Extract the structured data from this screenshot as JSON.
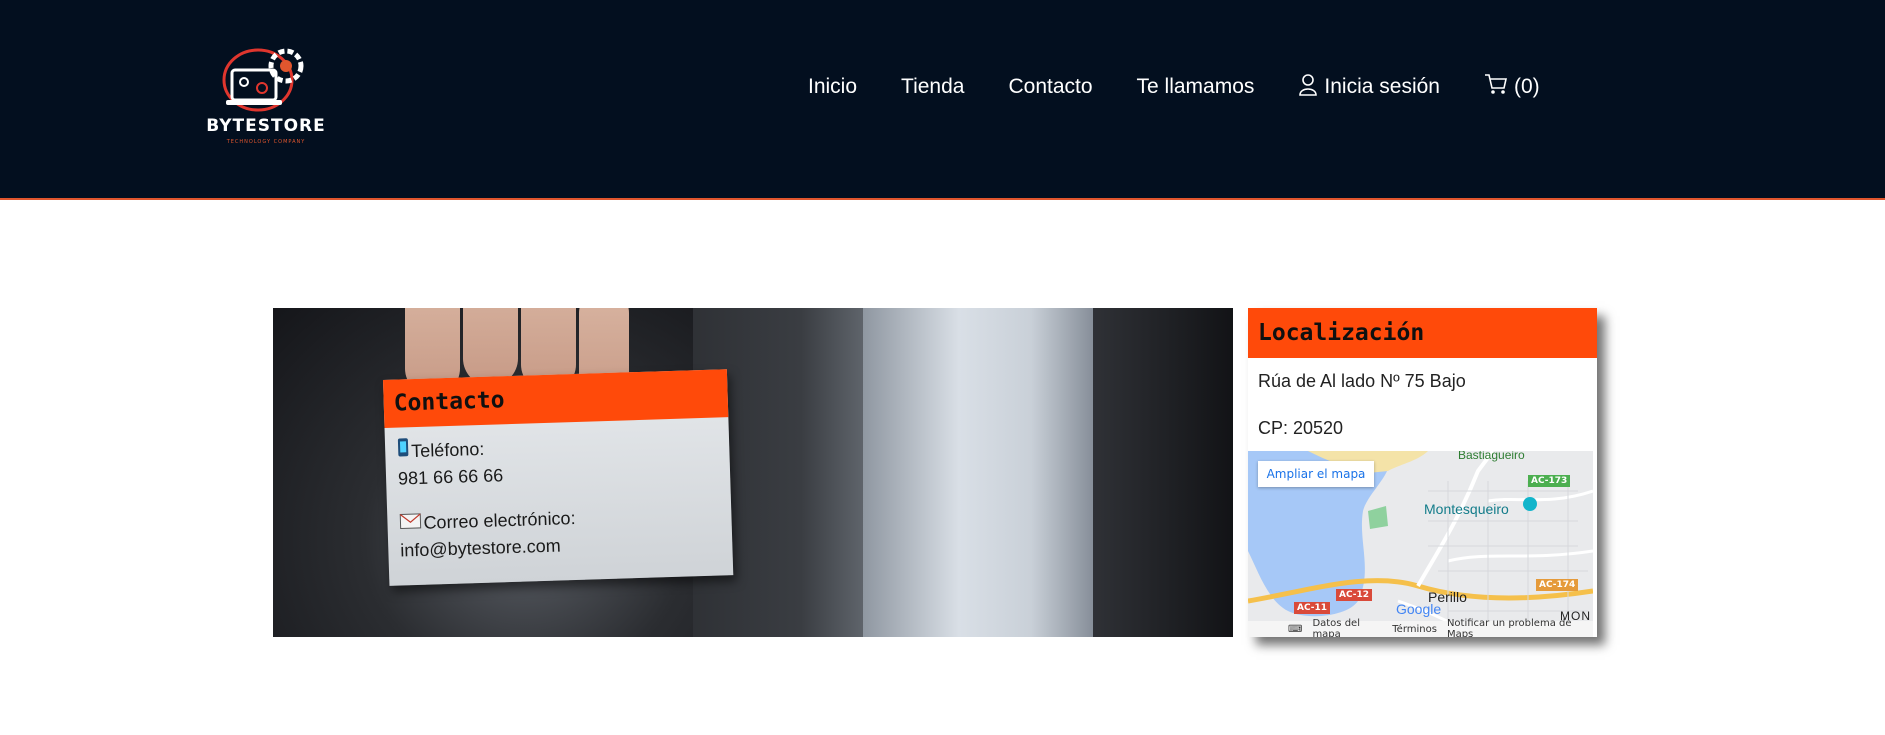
{
  "header": {
    "logo": {
      "word": "BYTESTORE",
      "tagline": "TECHNOLOGY COMPANY"
    },
    "nav": [
      "Inicio",
      "Tienda",
      "Contacto",
      "Te llamamos"
    ],
    "login": {
      "label": "Inicia sesión",
      "icon": "user-icon"
    },
    "cart": {
      "label": "(0)",
      "icon": "cart-icon"
    }
  },
  "contact": {
    "title": "Contacto",
    "phone_label": "Teléfono:",
    "phone": "981 66 66 66",
    "email_label": "Correo electrónico:",
    "email": "info@bytestore.com"
  },
  "location": {
    "title": "Localización",
    "address": "Rúa de Al lado Nº 75 Bajo",
    "postal": "CP: 20520",
    "map": {
      "enlarge": "Ampliar el mapa",
      "places": [
        "Bastiagueiro",
        "Montesqueiro",
        "Perillo",
        "MON"
      ],
      "roads": [
        "AC-173",
        "AC-174",
        "AC-12",
        "AC-11"
      ],
      "google": "Google",
      "footer": [
        "Datos del mapa",
        "Términos",
        "Notificar un problema de Maps"
      ]
    }
  },
  "colors": {
    "header_bg": "#030f1f",
    "accent": "#ff4a0a",
    "white": "#ffffff"
  }
}
